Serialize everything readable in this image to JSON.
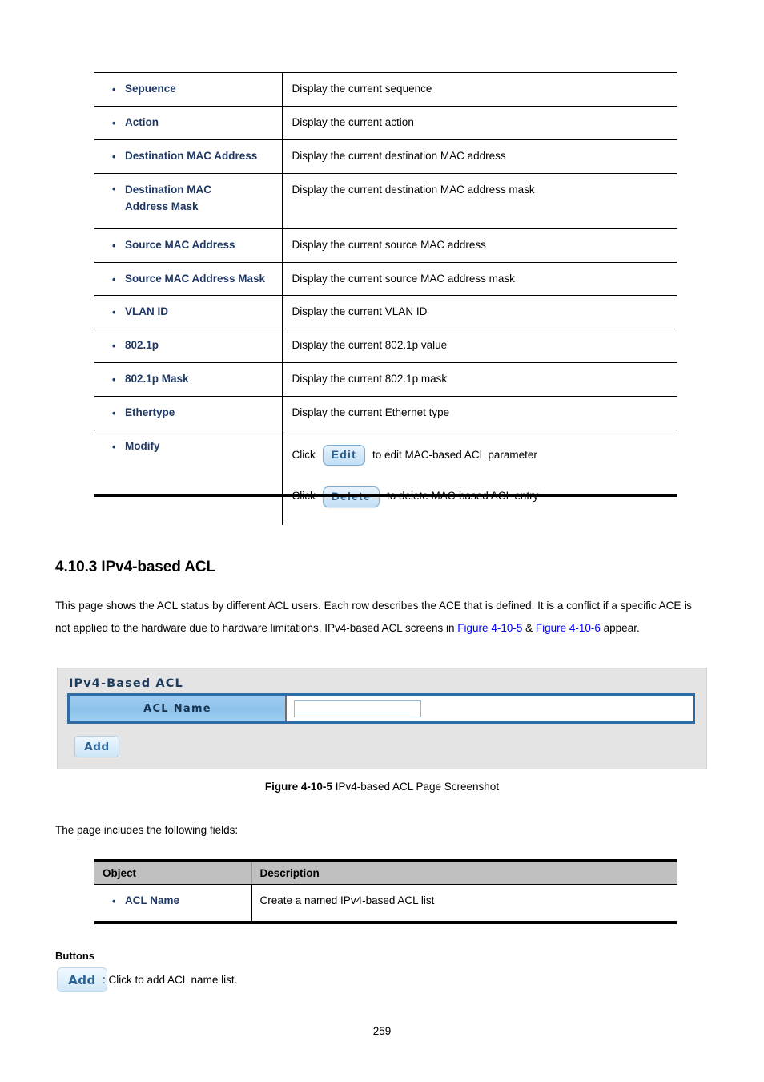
{
  "document": {
    "page_number": "259"
  },
  "mac_acl_table": {
    "rows": [
      {
        "object": "Sepuence",
        "description": "Display the current sequence"
      },
      {
        "object": "Action",
        "description": "Display the current action"
      },
      {
        "object": "Destination MAC Address",
        "description": "Display the current destination MAC address"
      },
      {
        "object": "Destination MAC Address Mask",
        "description": "Display the current destination MAC address mask"
      },
      {
        "object": "Source MAC Address",
        "description": "Display the current source MAC address"
      },
      {
        "object": "Source MAC Address Mask",
        "description": "Display the current source MAC address mask"
      },
      {
        "object": "VLAN ID",
        "description": "Display the current VLAN ID"
      },
      {
        "object": "802.1p",
        "description": "Display the current 802.1p value"
      },
      {
        "object": "802.1p Mask",
        "description": "Display the current 802.1p mask"
      },
      {
        "object": "Ethertype",
        "description": "Display the current Ethernet type"
      }
    ],
    "modify_row": {
      "object": "Modify",
      "edit_click_prefix": "Click",
      "edit_button_label": "Edit",
      "edit_click_suffix": "to edit MAC-based ACL parameter",
      "delete_click_prefix": "Click",
      "delete_button_label": "Delete",
      "delete_click_suffix": "to delete MAC-based ACL entry"
    }
  },
  "section": {
    "heading": "4.10.3 IPv4-based ACL",
    "paragraph_part1": "This page shows the ACL status by different ACL users. Each row describes the ACE that is defined. It is a conflict if a specific ACE is not applied to the hardware due to hardware limitations. IPv4-based ACL screens in ",
    "link1": "Figure 4-10-5",
    "paragraph_amp": " & ",
    "link2": "Figure 4-10-6",
    "paragraph_part2": " appear."
  },
  "acl_panel": {
    "title": "IPv4-Based ACL",
    "field_label": "ACL Name",
    "input_value": "",
    "input_placeholder": "",
    "add_button_label": "Add"
  },
  "figure": {
    "caption_bold": "Figure 4-10-5",
    "caption_text": " IPv4-based ACL Page Screenshot"
  },
  "fields_section": {
    "intro": "The page includes the following fields:",
    "headers": {
      "object": "Object",
      "description": "Description"
    },
    "rows": [
      {
        "object": "ACL Name",
        "description": "Create a named IPv4-based ACL list"
      }
    ]
  },
  "buttons_section": {
    "heading": "Buttons",
    "add_button_label": "Add",
    "add_description": ": Click to add ACL name list."
  },
  "colors": {
    "object_label": "#1F3864",
    "link": "#0000FF",
    "panel_background": "#E4E4E4",
    "panel_border_blue": "#2F6CA5",
    "field_label_blue": "#8DC2EC",
    "table_header_gray": "#C0C0C0"
  }
}
